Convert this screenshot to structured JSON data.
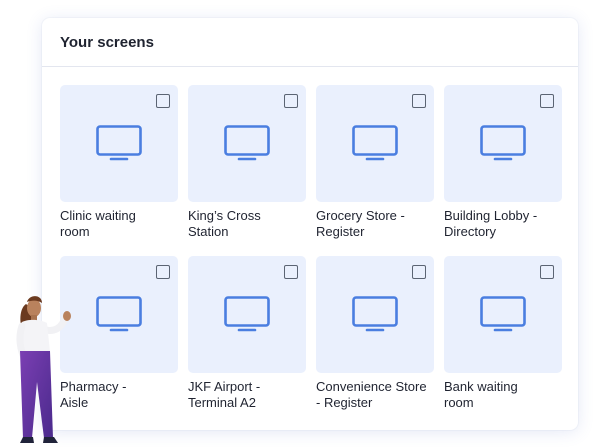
{
  "card": {
    "title": "Your screens"
  },
  "screens": [
    {
      "name": "Clinic waiting\nroom"
    },
    {
      "name": "King’s Cross\nStation"
    },
    {
      "name": "Grocery Store -\nRegister"
    },
    {
      "name": "Building Lobby -\nDirectory"
    },
    {
      "name": "Pharmacy  -\nAisle"
    },
    {
      "name": "JKF Airport -\nTerminal A2"
    },
    {
      "name": "Convenience Store\n- Register"
    },
    {
      "name": "Bank waiting\nroom"
    }
  ],
  "icons": {
    "tile": "monitor-icon",
    "select": "checkbox"
  },
  "colors": {
    "accent": "#4a7ee0",
    "tile_bg": "#eaf0fd"
  }
}
